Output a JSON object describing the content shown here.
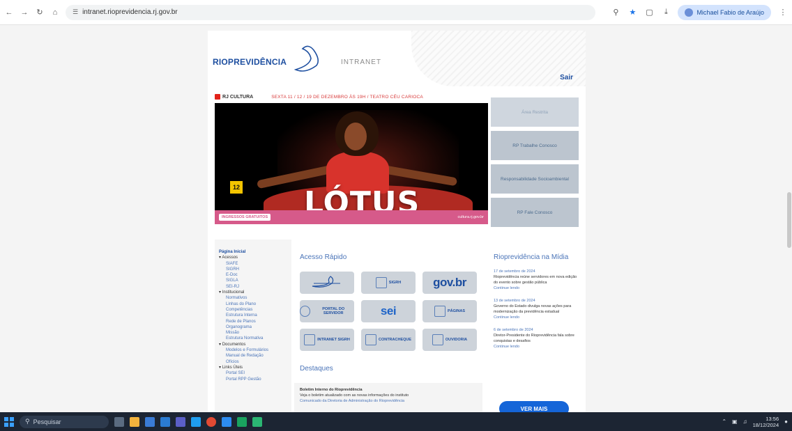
{
  "browser": {
    "url": "intranet.rioprevidencia.rj.gov.br",
    "profile_label": "Michael Fabio de Araújo"
  },
  "site": {
    "logo_text": "RIOPREVIDÊNCIA",
    "intranet_label": "INTRANET",
    "logout_label": "Sair"
  },
  "banner": {
    "brand": "RJ CULTURA",
    "dates": "SEXTA 11 / 12 / 19 DE DEZEMBRO ÀS 19H / TEATRO CÉU CARIOCA",
    "rating": "12",
    "title": "LÓTUS",
    "footer_left": "INGRESSOS GRATUITOS",
    "footer_right": "cultura.rj.gov.br"
  },
  "side_buttons": [
    {
      "label": "Área Restrita"
    },
    {
      "label": "RP Trabalhe Conosco"
    },
    {
      "label": "Responsabilidade Socioambiental"
    },
    {
      "label": "RP Fale Conosco"
    }
  ],
  "left_nav": {
    "root": "Página Inicial",
    "groups": [
      {
        "label": "Acessos",
        "items": [
          "SIAFE",
          "SIGRH",
          "E-Doc",
          "SIGLA",
          "SEI-RJ"
        ]
      },
      {
        "label": "Institucional",
        "items": [
          "Normativos",
          "Linhas do Plano",
          "Competências",
          "Estrutura Interna",
          "Rede de Planos",
          "Organograma",
          "Missão",
          "Estrutura Normativa"
        ]
      },
      {
        "label": "Documentos",
        "items": [
          "Modelos e Formulários",
          "Manual de Redação",
          "Ofícios"
        ]
      },
      {
        "label": "Links Úteis",
        "items": [
          "Portal SEI",
          "Portal RPP Gestão"
        ]
      }
    ]
  },
  "acesso_rapido": {
    "title": "Acesso Rápido",
    "tiles": [
      {
        "label": "",
        "kind": "logo"
      },
      {
        "label": "SIGRH",
        "kind": "icon"
      },
      {
        "label": "gov.br",
        "kind": "big"
      },
      {
        "label": "PORTAL DO SERVIDOR",
        "kind": "icon-round"
      },
      {
        "label": "sei",
        "kind": "big"
      },
      {
        "label": "PÁGINAS",
        "kind": "icon"
      },
      {
        "label": "INTRANET SIGRH",
        "kind": "icon"
      },
      {
        "label": "CONTRACHEQUE",
        "kind": "icon"
      },
      {
        "label": "OUVIDORIA",
        "kind": "icon"
      }
    ]
  },
  "destaques": {
    "title": "Destaques",
    "lines": [
      "Boletim Interno do Rioprevidência",
      "Veja o boletim atualizado com as novas informações do instituto",
      "Comunicado da Diretoria de Administração do Rioprevidência"
    ]
  },
  "midia": {
    "title": "Rioprevidência na Mídia",
    "items": [
      {
        "date": "17 de setembro de 2024",
        "text": "Rioprevidência reúne servidores em nova edição do evento sobre gestão pública",
        "more": "Continue lendo"
      },
      {
        "date": "13 de setembro de 2024",
        "text": "Governo do Estado divulga novas ações para modernização da previdência estadual",
        "more": "Continue lendo"
      },
      {
        "date": "6 de setembro de 2024",
        "text": "Diretor-Presidente do Rioprevidência fala sobre conquistas e desafios",
        "more": "Continue lendo"
      }
    ],
    "button_label": "VER MAIS"
  },
  "taskbar": {
    "search_placeholder": "Pesquisar",
    "time": "13:56",
    "date": "18/12/2024"
  },
  "colors": {
    "brand_blue": "#1e4fa0",
    "banner_pink": "#d65a8a",
    "tile_gray": "#cdd3da",
    "taskbar": "#1c2533"
  }
}
